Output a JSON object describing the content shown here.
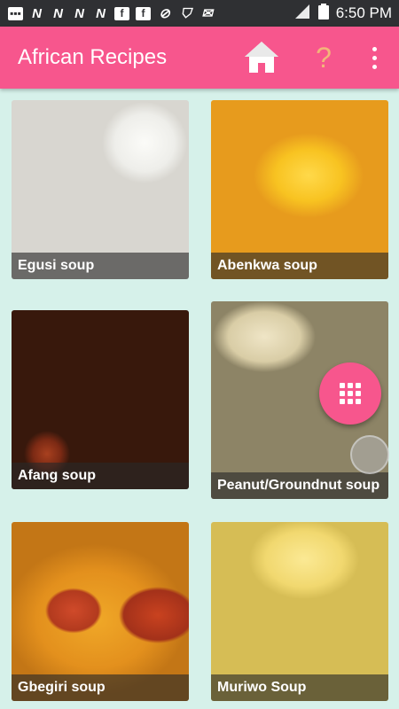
{
  "status_bar": {
    "time": "6:50 PM",
    "left_icons": [
      "message-icon",
      "n-icon",
      "n-icon",
      "n-icon",
      "n-icon",
      "facebook-icon",
      "facebook-icon",
      "compass-icon",
      "shield-icon",
      "mail-icon"
    ],
    "right_icons": [
      "signal-icon",
      "battery-icon"
    ]
  },
  "app_bar": {
    "title": "African Recipes",
    "help_glyph": "?",
    "color": "#f7568d"
  },
  "recipes": [
    {
      "name": "Egusi soup"
    },
    {
      "name": "Abenkwa soup"
    },
    {
      "name": "Afang soup"
    },
    {
      "name": "Peanut/Groundnut soup"
    },
    {
      "name": "Gbegiri soup"
    },
    {
      "name": "Muriwo Soup"
    }
  ],
  "fab": {
    "icon": "grid-icon",
    "color": "#f7568d"
  },
  "colors": {
    "background": "#d6f1ea",
    "status_bar": "#2f3033"
  }
}
